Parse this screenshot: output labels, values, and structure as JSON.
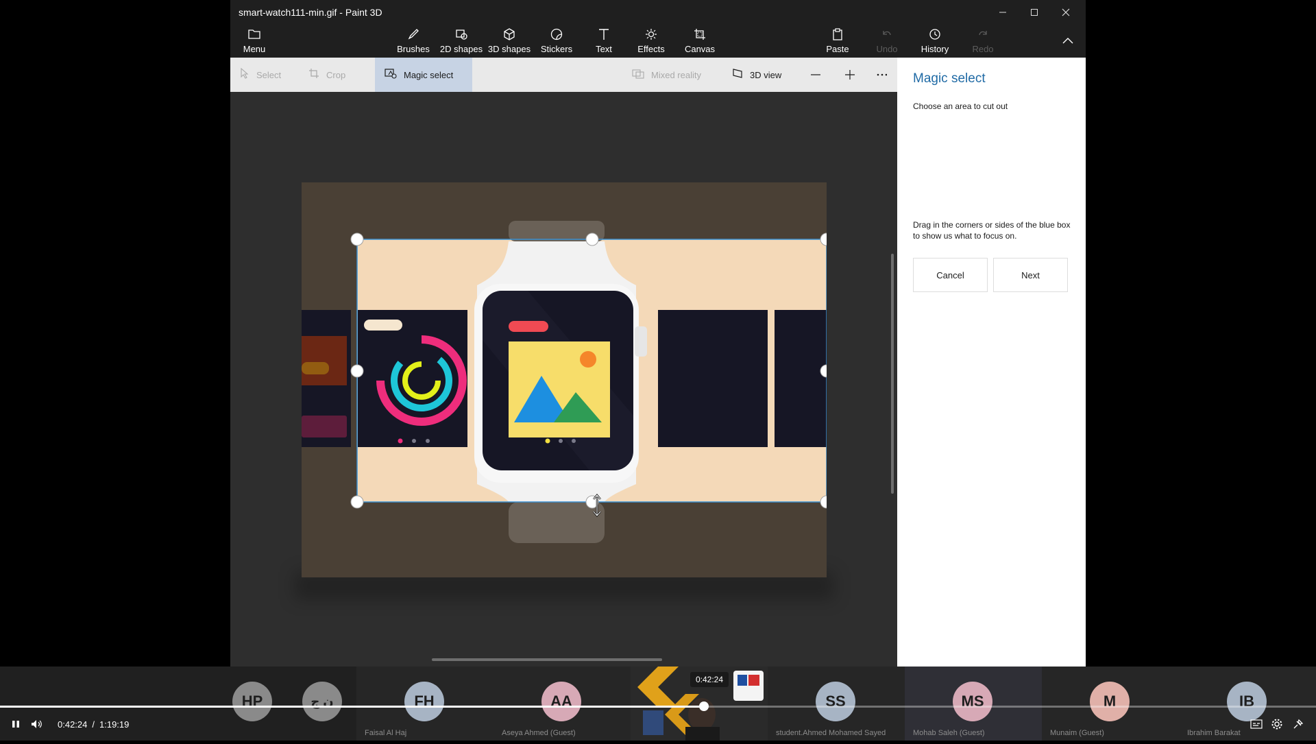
{
  "window": {
    "title": "smart-watch111-min.gif - Paint 3D",
    "controls": [
      "minimize",
      "maximize",
      "close"
    ]
  },
  "toolbar": {
    "menu": "Menu",
    "tools": [
      "Brushes",
      "2D shapes",
      "3D shapes",
      "Stickers",
      "Text",
      "Effects",
      "Canvas"
    ],
    "paste": "Paste",
    "undo": "Undo",
    "history": "History",
    "redo": "Redo"
  },
  "subbar": {
    "select": "Select",
    "crop": "Crop",
    "magic_select": "Magic select",
    "mixed_reality": "Mixed reality",
    "view_3d": "3D view"
  },
  "panel": {
    "title": "Magic select",
    "instruction": "Choose an area to cut out",
    "hint": "Drag in the corners or sides of the blue box to show us what to focus on.",
    "cancel": "Cancel",
    "next": "Next"
  },
  "participants": [
    {
      "initials": "HP",
      "name": "",
      "color": "#8a8a8a"
    },
    {
      "initials": "ن ج",
      "name": "",
      "color": "#8a8a8a"
    },
    {
      "initials": "FH",
      "name": "Faisal Al Haj",
      "color": "#a7b4c4"
    },
    {
      "initials": "AA",
      "name": "Aseya Ahmed (Guest)",
      "color": "#d7a9b6"
    },
    {
      "initials": "",
      "name": "",
      "color": ""
    },
    {
      "initials": "SS",
      "name": "student.Ahmed Mohamed Sayed",
      "color": "#a7b4c4"
    },
    {
      "initials": "MS",
      "name": "Mohab Saleh (Guest)",
      "color": "#d7a9b6"
    },
    {
      "initials": "M",
      "name": "Munaim (Guest)",
      "color": "#e0b0a8"
    },
    {
      "initials": "IB",
      "name": "Ibrahim Barakat",
      "color": "#a7b4c4"
    }
  ],
  "player": {
    "current_time": "0:42:24",
    "separator": "/",
    "duration": "1:19:19",
    "tooltip_time": "0:42:24",
    "progress": 0.535,
    "accent": "#ffffff"
  },
  "colors": {
    "panel_title": "#1f6aa5",
    "selection": "#3a8fd1",
    "canvas_bg": "#f6dcbc"
  }
}
